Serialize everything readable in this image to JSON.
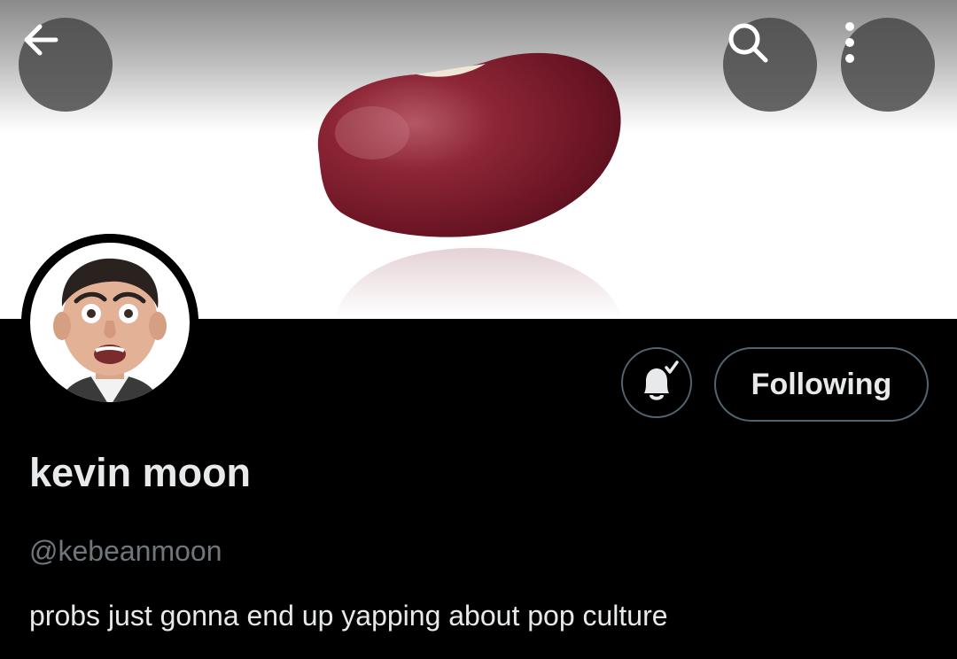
{
  "header": {
    "banner_image": "red kidney bean",
    "back_icon": "arrow-left-icon",
    "search_icon": "search-icon",
    "more_icon": "more-vertical-icon"
  },
  "profile": {
    "avatar": "profile photo",
    "display_name": "kevin moon",
    "handle": "@kebeanmoon",
    "bio": "probs just gonna end up yapping about pop culture"
  },
  "actions": {
    "notifications_icon": "bell-check-icon",
    "following_label": "Following"
  },
  "colors": {
    "background": "#000000",
    "text_primary": "#e7e9ea",
    "text_secondary": "#71767b",
    "button_border": "#536471",
    "overlay_button": "#464646"
  }
}
